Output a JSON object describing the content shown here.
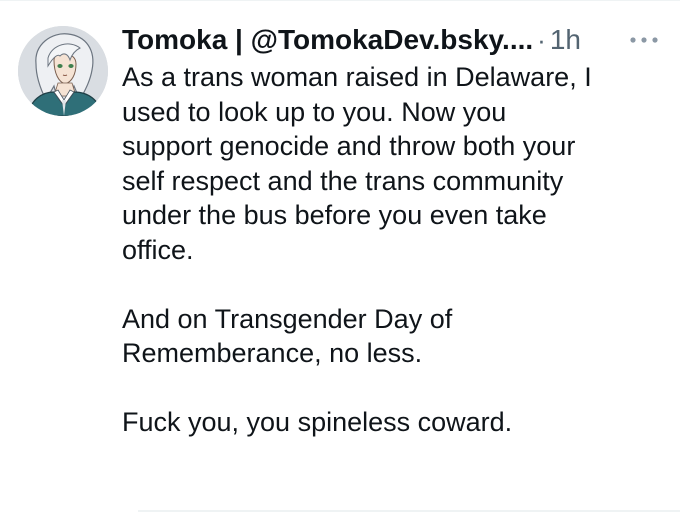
{
  "tweet": {
    "display_name": "Tomoka | @TomokaDev.bsky....",
    "separator": "·",
    "timestamp": "1h",
    "more_icon": "more-horizontal-icon",
    "avatar_icon": "avatar-image",
    "paragraph_1_lines": [
      "As a trans woman raised in Delaware, I",
      "used to look up to you. Now you",
      "support genocide and throw both your",
      "self respect and the trans community",
      "under the bus before you even take",
      "office."
    ],
    "paragraph_2_lines": [
      "And on Transgender Day of",
      "Rememberance, no less."
    ],
    "paragraph_3_lines": [
      "Fuck you, you spineless coward."
    ]
  },
  "colors": {
    "text_primary": "#0f1419",
    "text_secondary": "#536471",
    "divider": "#eff3f4",
    "background": "#ffffff"
  }
}
